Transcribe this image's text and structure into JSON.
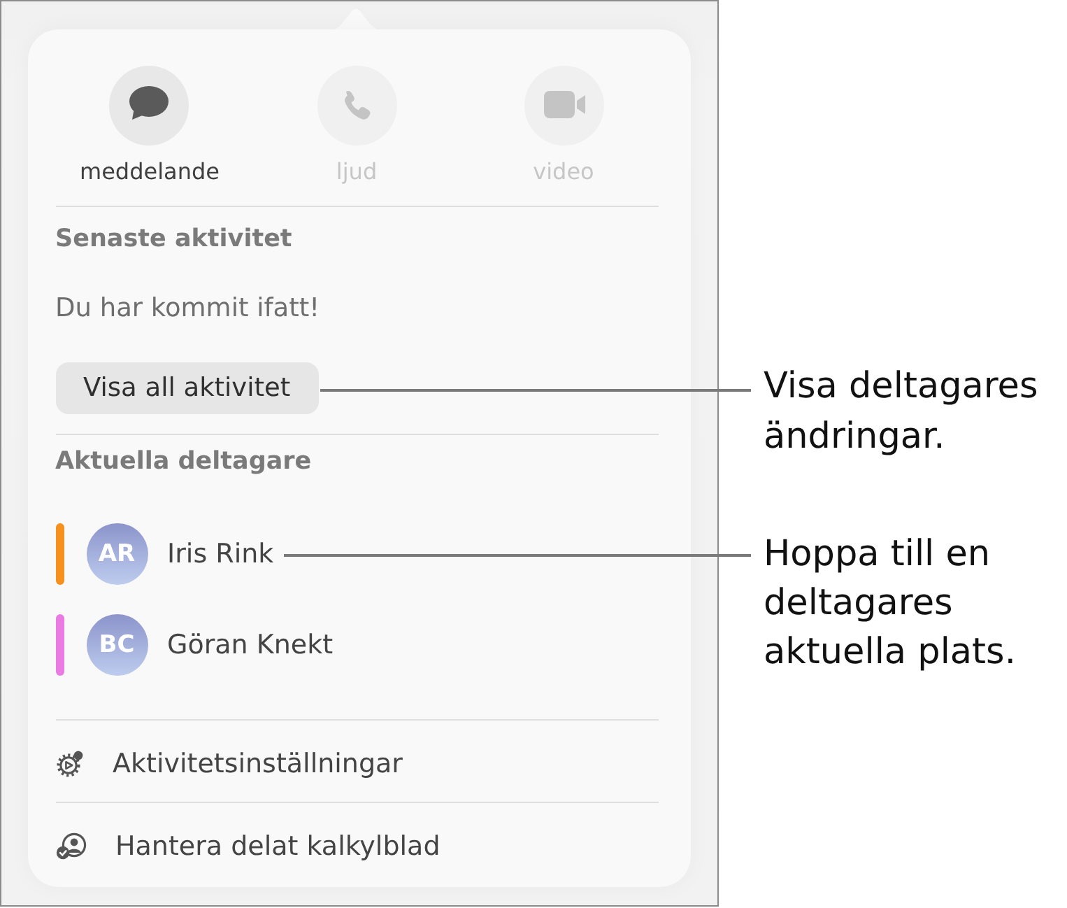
{
  "actions": [
    {
      "label": "meddelande",
      "kind": "message",
      "disabled": false
    },
    {
      "label": "ljud",
      "kind": "audio",
      "disabled": true
    },
    {
      "label": "video",
      "kind": "video",
      "disabled": true
    }
  ],
  "recent_activity": {
    "heading": "Senaste aktivitet",
    "message": "Du har kommit ifatt!",
    "button": "Visa all aktivitet"
  },
  "participants": {
    "heading": "Aktuella deltagare",
    "items": [
      {
        "initials": "AR",
        "name": "Iris Rink",
        "color": "#f7911e"
      },
      {
        "initials": "BC",
        "name": "Göran Knekt",
        "color": "#ea7be2"
      }
    ]
  },
  "menu": [
    {
      "label": "Aktivitetsinställningar",
      "kind": "settings"
    },
    {
      "label": "Hantera delat kalkylblad",
      "kind": "share"
    }
  ],
  "callouts": [
    {
      "text": "Visa deltagares ändringar."
    },
    {
      "text": "Hoppa till en deltagares aktuella plats."
    }
  ]
}
